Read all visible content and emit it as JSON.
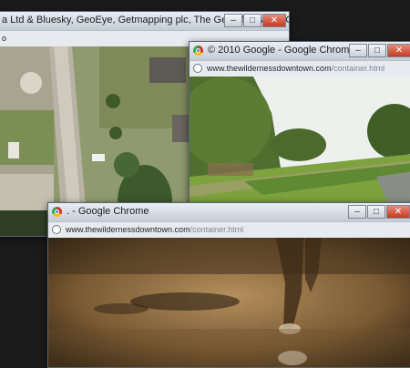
{
  "windows": {
    "map": {
      "title": "a Ltd & Bluesky, GeoEye, Getmapping plc, The GeoInformation Group - G...",
      "url_prefix": "o"
    },
    "street": {
      "title": "© 2010 Google - Google Chrome",
      "url_host": "www.thewildernessdowntown.com",
      "url_path": "/container.html"
    },
    "run": {
      "title": ". - Google Chrome",
      "url_host": "www.thewildernessdowntown.com",
      "url_path": "/container.html"
    }
  },
  "controls": {
    "minimize": "–",
    "maximize": "□",
    "close": "✕"
  }
}
